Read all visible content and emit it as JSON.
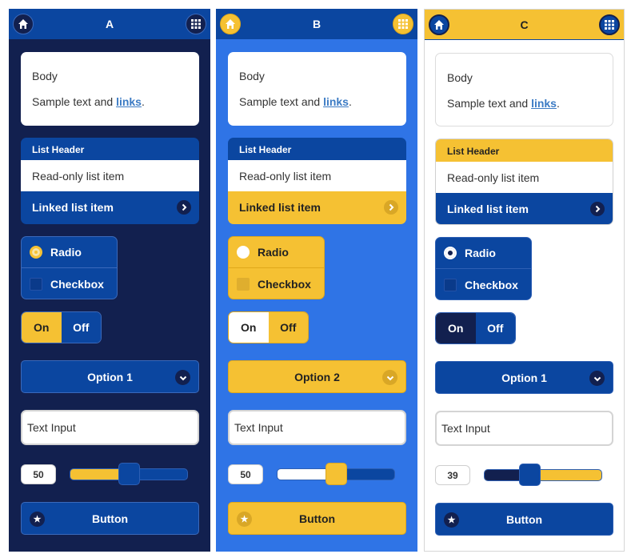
{
  "panels": {
    "a": {
      "title": "A",
      "body": {
        "heading": "Body",
        "text": "Sample text and ",
        "link": "links",
        "suffix": "."
      },
      "list": {
        "header": "List Header",
        "readonly": "Read-only list item",
        "linked": "Linked list item"
      },
      "radio_label": "Radio",
      "checkbox_label": "Checkbox",
      "toggle": {
        "on": "On",
        "off": "Off",
        "active": "On"
      },
      "select_value": "Option 1",
      "text_input": "Text Input",
      "slider_value": "50",
      "slider_percent": 50,
      "button_label": "Button"
    },
    "b": {
      "title": "B",
      "body": {
        "heading": "Body",
        "text": "Sample text and ",
        "link": "links",
        "suffix": "."
      },
      "list": {
        "header": "List Header",
        "readonly": "Read-only list item",
        "linked": "Linked list item"
      },
      "radio_label": "Radio",
      "checkbox_label": "Checkbox",
      "toggle": {
        "on": "On",
        "off": "Off",
        "active": "On"
      },
      "select_value": "Option 2",
      "text_input": "Text Input",
      "slider_value": "50",
      "slider_percent": 50,
      "button_label": "Button"
    },
    "c": {
      "title": "C",
      "body": {
        "heading": "Body",
        "text": "Sample text and ",
        "link": "links",
        "suffix": "."
      },
      "list": {
        "header": "List Header",
        "readonly": "Read-only list item",
        "linked": "Linked list item"
      },
      "radio_label": "Radio",
      "checkbox_label": "Checkbox",
      "toggle": {
        "on": "On",
        "off": "Off",
        "active": "On"
      },
      "select_value": "Option 1",
      "text_input": "Text Input",
      "slider_value": "39",
      "slider_percent": 39,
      "button_label": "Button"
    }
  },
  "icons": {
    "home": "home-icon",
    "grid": "grid-icon",
    "chevron_right": "chevron-right-icon",
    "chevron_down": "chevron-down-icon",
    "star": "star-icon"
  },
  "colors": {
    "navy": "#12204f",
    "royal_blue": "#0b46a0",
    "bright_blue": "#2f74e6",
    "yellow": "#f5c133",
    "white": "#ffffff"
  }
}
